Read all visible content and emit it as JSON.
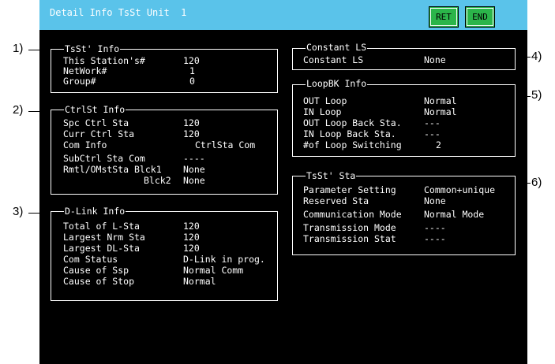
{
  "title": "Detail Info TsSt Unit  1",
  "buttons": {
    "ret": "RET",
    "end": "END"
  },
  "callouts": [
    "1)",
    "2)",
    "3)",
    "4)",
    "5)",
    "6)"
  ],
  "tsst_info": {
    "header": "TsSt' Info",
    "rows": [
      {
        "label": "This Station's#",
        "value": "120"
      },
      {
        "label": "NetWork#",
        "value": "1"
      },
      {
        "label": "Group#",
        "value": "0"
      }
    ]
  },
  "ctrlst_info": {
    "header": "CtrlSt Info",
    "rows": [
      {
        "label": "Spc Ctrl Sta",
        "value": "120"
      },
      {
        "label": "Curr Ctrl Sta",
        "value": "120"
      },
      {
        "label": "Com Info",
        "value": "CtrlSta Com"
      },
      {
        "label": "SubCtrl Sta Com",
        "value": "----"
      },
      {
        "label": "Rmtl/OMstSta Blck1",
        "value": "None"
      },
      {
        "label": "Blck2",
        "value": "None"
      }
    ]
  },
  "dlink_info": {
    "header": "D-Link Info",
    "rows": [
      {
        "label": "Total of L-Sta",
        "value": "120"
      },
      {
        "label": "Largest Nrm Sta",
        "value": "120"
      },
      {
        "label": "Largest DL-Sta",
        "value": "120"
      },
      {
        "label": "Com Status",
        "value": "D-Link in prog."
      },
      {
        "label": "Cause of Ssp",
        "value": "Normal Comm"
      },
      {
        "label": "Cause of Stop",
        "value": "Normal"
      }
    ]
  },
  "constant_ls": {
    "header": "Constant LS",
    "rows": [
      {
        "label": "Constant LS",
        "value": "None"
      }
    ]
  },
  "loopbk_info": {
    "header": "LoopBK Info",
    "rows": [
      {
        "label": "OUT Loop",
        "value": "Normal"
      },
      {
        "label": "IN Loop",
        "value": "Normal"
      },
      {
        "label": "OUT Loop Back Sta.",
        "value": "---"
      },
      {
        "label": "IN Loop Back Sta.",
        "value": "---"
      },
      {
        "label": "#of Loop Switching",
        "value": "2"
      }
    ]
  },
  "tsst_sta": {
    "header": "TsSt' Sta",
    "rows": [
      {
        "label": "Parameter Setting",
        "value": "Common+unique"
      },
      {
        "label": "Reserved Sta",
        "value": "None"
      },
      {
        "label": "Communication Mode",
        "value": "Normal Mode"
      },
      {
        "label": "Transmission Mode",
        "value": "----"
      },
      {
        "label": "Transmission Stat",
        "value": "----"
      }
    ]
  }
}
